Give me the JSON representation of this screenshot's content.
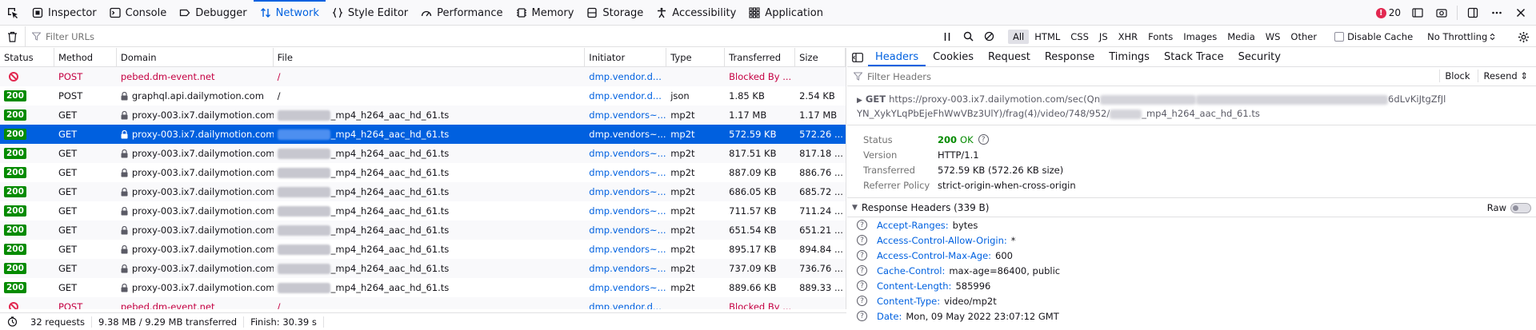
{
  "toolbox": {
    "tabs": [
      {
        "label": "Inspector",
        "icon": "inspector-icon"
      },
      {
        "label": "Console",
        "icon": "console-icon"
      },
      {
        "label": "Debugger",
        "icon": "debugger-icon"
      },
      {
        "label": "Network",
        "icon": "network-icon",
        "active": true
      },
      {
        "label": "Style Editor",
        "icon": "style-editor-icon"
      },
      {
        "label": "Performance",
        "icon": "performance-icon"
      },
      {
        "label": "Memory",
        "icon": "memory-icon"
      },
      {
        "label": "Storage",
        "icon": "storage-icon"
      },
      {
        "label": "Accessibility",
        "icon": "accessibility-icon"
      },
      {
        "label": "Application",
        "icon": "application-icon"
      }
    ],
    "error_count": "20"
  },
  "filterbar": {
    "placeholder": "Filter URLs",
    "types": [
      "All",
      "HTML",
      "CSS",
      "JS",
      "XHR",
      "Fonts",
      "Images",
      "Media",
      "WS",
      "Other"
    ],
    "active_type": "All",
    "disable_cache": "Disable Cache",
    "throttling": "No Throttling"
  },
  "columns": [
    "Status",
    "Method",
    "Domain",
    "File",
    "Initiator",
    "Type",
    "Transferred",
    "Size"
  ],
  "requests": [
    {
      "status": "blocked",
      "method": "POST",
      "domain": "pebed.dm-event.net",
      "lock": false,
      "file": "/",
      "file_blurred": false,
      "initiator": "dmp.vendor.d...",
      "type": "",
      "transferred": "Blocked By ...",
      "size": ""
    },
    {
      "status": "200",
      "method": "POST",
      "domain": "graphql.api.dailymotion.com",
      "lock": true,
      "file": "/",
      "file_blurred": false,
      "initiator": "dmp.vendor.d...",
      "type": "json",
      "transferred": "1.85 KB",
      "size": "2.54 KB"
    },
    {
      "status": "200",
      "method": "GET",
      "domain": "proxy-003.ix7.dailymotion.com",
      "lock": true,
      "file": "_mp4_h264_aac_hd_61.ts",
      "file_blurred": true,
      "initiator": "dmp.vendors~...",
      "type": "mp2t",
      "transferred": "1.17 MB",
      "size": "1.17 MB"
    },
    {
      "status": "200",
      "method": "GET",
      "domain": "proxy-003.ix7.dailymotion.com",
      "lock": true,
      "file": "_mp4_h264_aac_hd_61.ts",
      "file_blurred": true,
      "initiator": "dmp.vendors~...",
      "type": "mp2t",
      "transferred": "572.59 KB",
      "size": "572.26 ...",
      "selected": true
    },
    {
      "status": "200",
      "method": "GET",
      "domain": "proxy-003.ix7.dailymotion.com",
      "lock": true,
      "file": "_mp4_h264_aac_hd_61.ts",
      "file_blurred": true,
      "initiator": "dmp.vendors~...",
      "type": "mp2t",
      "transferred": "817.51 KB",
      "size": "817.18 ..."
    },
    {
      "status": "200",
      "method": "GET",
      "domain": "proxy-003.ix7.dailymotion.com",
      "lock": true,
      "file": "_mp4_h264_aac_hd_61.ts",
      "file_blurred": true,
      "initiator": "dmp.vendors~...",
      "type": "mp2t",
      "transferred": "887.09 KB",
      "size": "886.76 ..."
    },
    {
      "status": "200",
      "method": "GET",
      "domain": "proxy-003.ix7.dailymotion.com",
      "lock": true,
      "file": "_mp4_h264_aac_hd_61.ts",
      "file_blurred": true,
      "initiator": "dmp.vendors~...",
      "type": "mp2t",
      "transferred": "686.05 KB",
      "size": "685.72 ..."
    },
    {
      "status": "200",
      "method": "GET",
      "domain": "proxy-003.ix7.dailymotion.com",
      "lock": true,
      "file": "_mp4_h264_aac_hd_61.ts",
      "file_blurred": true,
      "initiator": "dmp.vendors~...",
      "type": "mp2t",
      "transferred": "711.57 KB",
      "size": "711.24 ..."
    },
    {
      "status": "200",
      "method": "GET",
      "domain": "proxy-003.ix7.dailymotion.com",
      "lock": true,
      "file": "_mp4_h264_aac_hd_61.ts",
      "file_blurred": true,
      "initiator": "dmp.vendors~...",
      "type": "mp2t",
      "transferred": "651.54 KB",
      "size": "651.21 ..."
    },
    {
      "status": "200",
      "method": "GET",
      "domain": "proxy-003.ix7.dailymotion.com",
      "lock": true,
      "file": "_mp4_h264_aac_hd_61.ts",
      "file_blurred": true,
      "initiator": "dmp.vendors~...",
      "type": "mp2t",
      "transferred": "895.17 KB",
      "size": "894.84 ..."
    },
    {
      "status": "200",
      "method": "GET",
      "domain": "proxy-003.ix7.dailymotion.com",
      "lock": true,
      "file": "_mp4_h264_aac_hd_61.ts",
      "file_blurred": true,
      "initiator": "dmp.vendors~...",
      "type": "mp2t",
      "transferred": "737.09 KB",
      "size": "736.76 ..."
    },
    {
      "status": "200",
      "method": "GET",
      "domain": "proxy-003.ix7.dailymotion.com",
      "lock": true,
      "file": "_mp4_h264_aac_hd_61.ts",
      "file_blurred": true,
      "initiator": "dmp.vendors~...",
      "type": "mp2t",
      "transferred": "889.66 KB",
      "size": "889.33 ..."
    },
    {
      "status": "blocked",
      "method": "POST",
      "domain": "pebed.dm-event.net",
      "lock": false,
      "file": "/",
      "file_blurred": false,
      "initiator": "dmp.vendor.d...",
      "type": "",
      "transferred": "Blocked By ...",
      "size": ""
    }
  ],
  "statusbar": {
    "requests": "32 requests",
    "transferred": "9.38 MB / 9.29 MB transferred",
    "finish": "Finish: 30.39 s"
  },
  "details": {
    "tabs": [
      "Headers",
      "Cookies",
      "Request",
      "Response",
      "Timings",
      "Stack Trace",
      "Security"
    ],
    "active_tab": "Headers",
    "filter_placeholder": "Filter Headers",
    "block_label": "Block",
    "resend_label": "Resend",
    "request_method": "GET",
    "url_part1": "https://proxy-003.ix7.dailymotion.com/sec(Qn",
    "url_part2": "6dLvKiJtgZfJl",
    "url_line2a": "YN_XykYLqPbEjeFhWwVBz3UlY)/frag(4)/video/748/952/",
    "url_line2b": "_mp4_h264_aac_hd_61.ts",
    "summary": {
      "status_key": "Status",
      "status_code": "200",
      "status_text": "OK",
      "version_key": "Version",
      "version": "HTTP/1.1",
      "transferred_key": "Transferred",
      "transferred": "572.59 KB (572.26 KB size)",
      "referrer_key": "Referrer Policy",
      "referrer": "strict-origin-when-cross-origin"
    },
    "response_headers_title": "Response Headers (339 B)",
    "raw_label": "Raw",
    "response_headers": [
      {
        "name": "Accept-Ranges:",
        "value": "bytes"
      },
      {
        "name": "Access-Control-Allow-Origin:",
        "value": "*"
      },
      {
        "name": "Access-Control-Max-Age:",
        "value": "600"
      },
      {
        "name": "Cache-Control:",
        "value": "max-age=86400, public"
      },
      {
        "name": "Content-Length:",
        "value": "585996"
      },
      {
        "name": "Content-Type:",
        "value": "video/mp2t"
      },
      {
        "name": "Date:",
        "value": "Mon, 09 May 2022 23:07:12 GMT"
      }
    ]
  },
  "colors": {
    "accent": "#0061e0",
    "selected_row": "#0060df",
    "status_ok": "#058b00",
    "blocked": "#c50042",
    "error_badge": "#e22850"
  }
}
